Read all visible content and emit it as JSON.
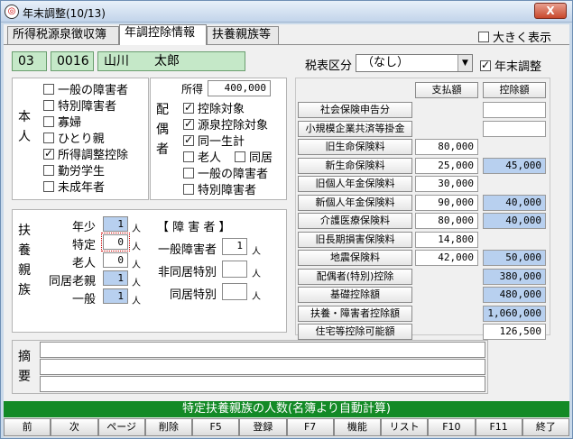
{
  "window": {
    "title": "年末調整(10/13)",
    "close_label": "X"
  },
  "tabs": [
    {
      "label": "所得税源泉徴収簿"
    },
    {
      "label": "年調控除情報"
    },
    {
      "label": "扶養親族等"
    }
  ],
  "large_display_label": "大きく表示",
  "employee": {
    "dept": "03",
    "code": "0016",
    "name": "山川　　太郎"
  },
  "tax_class": {
    "label": "税表区分",
    "value": "（なし）"
  },
  "year_end_label": "年末調整",
  "honnin": {
    "label": "本人",
    "items": [
      {
        "label": "一般の障害者",
        "checked": false
      },
      {
        "label": "特別障害者",
        "checked": false
      },
      {
        "label": "寡婦",
        "checked": false
      },
      {
        "label": "ひとり親",
        "checked": false
      },
      {
        "label": "所得調整控除",
        "checked": true
      },
      {
        "label": "勤労学生",
        "checked": false
      },
      {
        "label": "未成年者",
        "checked": false
      }
    ]
  },
  "spouse": {
    "label": "配偶者",
    "income_label": "所得",
    "income_value": "400,000",
    "items": [
      {
        "label": "控除対象",
        "checked": true
      },
      {
        "label": "源泉控除対象",
        "checked": true
      },
      {
        "label": "同一生計",
        "checked": true
      },
      {
        "label": "老人",
        "checked": false
      },
      {
        "label": "同居",
        "checked": false
      },
      {
        "label": "一般の障害者",
        "checked": false
      },
      {
        "label": "特別障害者",
        "checked": false
      }
    ]
  },
  "dependents": {
    "label": "扶養親族",
    "unit": "人",
    "rows": [
      {
        "label": "年少",
        "value": "1"
      },
      {
        "label": "特定",
        "value": "0"
      },
      {
        "label": "老人",
        "value": "0"
      },
      {
        "label": "同居老親",
        "value": "1"
      },
      {
        "label": "一般",
        "value": "1"
      }
    ],
    "disability_title": "【 障 害 者 】",
    "disability_rows": [
      {
        "label": "一般障害者",
        "value": "1"
      },
      {
        "label": "非同居特別",
        "value": ""
      },
      {
        "label": "同居特別",
        "value": ""
      }
    ]
  },
  "deductions": {
    "header_paid": "支払額",
    "header_deduction": "控除額",
    "rows": [
      {
        "label": "社会保険申告分",
        "paid": "",
        "deduction": ""
      },
      {
        "label": "小規模企業共済等掛金",
        "paid": "",
        "deduction": ""
      },
      {
        "label": "旧生命保険料",
        "paid": "80,000",
        "deduction": ""
      },
      {
        "label": "新生命保険料",
        "paid": "25,000",
        "deduction": "45,000"
      },
      {
        "label": "旧個人年金保険料",
        "paid": "30,000",
        "deduction": ""
      },
      {
        "label": "新個人年金保険料",
        "paid": "90,000",
        "deduction": "40,000"
      },
      {
        "label": "介護医療保険料",
        "paid": "80,000",
        "deduction": "40,000"
      },
      {
        "label": "旧長期損害保険料",
        "paid": "14,800",
        "deduction": ""
      },
      {
        "label": "地震保険料",
        "paid": "42,000",
        "deduction": "50,000"
      },
      {
        "label": "配偶者(特別)控除",
        "paid": "",
        "deduction": "380,000"
      },
      {
        "label": "基礎控除額",
        "paid": "",
        "deduction": "480,000"
      },
      {
        "label": "扶養・障害者控除額",
        "paid": "",
        "deduction": "1,060,000"
      },
      {
        "label": "住宅等控除可能額",
        "paid": "",
        "deduction": "126,500"
      }
    ]
  },
  "memo": {
    "label": "摘要"
  },
  "status_text": "特定扶養親族の人数(名簿より自動計算)",
  "function_keys": [
    "前",
    "次",
    "ページ",
    "削除",
    "F5",
    "登録",
    "F7",
    "機能",
    "リスト",
    "F10",
    "F11",
    "終了"
  ],
  "colors": {
    "status_bar": "#138a26",
    "blue_field": "#b8d0ef",
    "name_field": "#c5e8c8"
  }
}
